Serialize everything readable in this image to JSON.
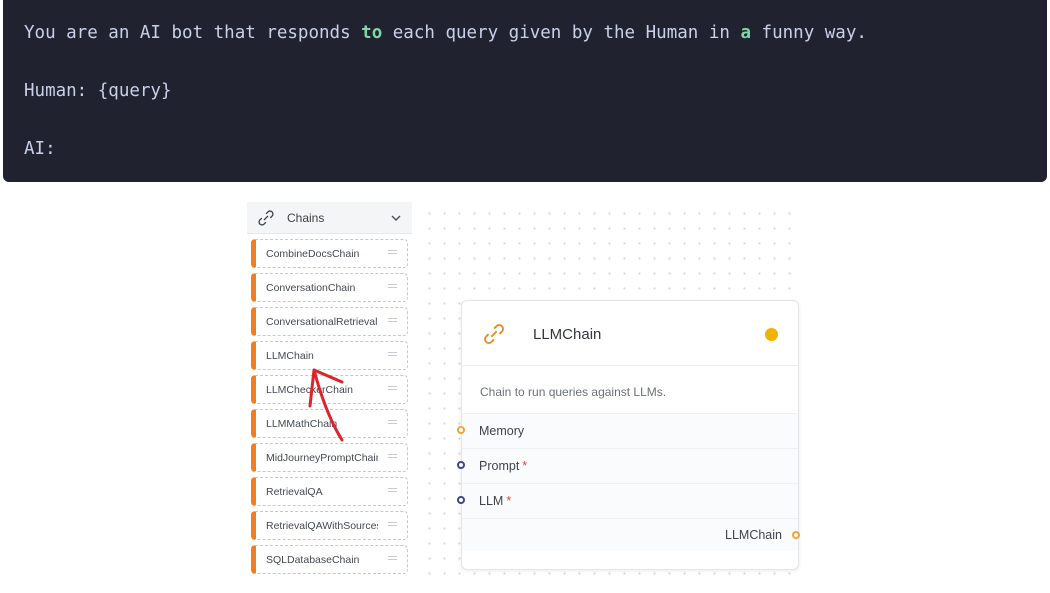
{
  "code": {
    "line1_parts": [
      {
        "text": "You are an AI bot that responds ",
        "kw": false
      },
      {
        "text": "to",
        "kw": true
      },
      {
        "text": " each query given by the Human in ",
        "kw": false
      },
      {
        "text": "a",
        "kw": true
      },
      {
        "text": " funny way.",
        "kw": false
      }
    ],
    "line2": "Human: {query}",
    "line3": "AI:"
  },
  "sidebar": {
    "title": "Chains",
    "header_icon": "link-icon",
    "collapse_icon": "chevron-down-icon",
    "items": [
      {
        "label": "CombineDocsChain"
      },
      {
        "label": "ConversationChain"
      },
      {
        "label": "ConversationalRetrieval..."
      },
      {
        "label": "LLMChain"
      },
      {
        "label": "LLMCheckerChain"
      },
      {
        "label": "LLMMathChain"
      },
      {
        "label": "MidJourneyPromptChain"
      },
      {
        "label": "RetrievalQA"
      },
      {
        "label": "RetrievalQAWithSources..."
      },
      {
        "label": "SQLDatabaseChain"
      }
    ],
    "item_accent_color": "#f37d1f"
  },
  "node": {
    "title": "LLMChain",
    "icon": "link-icon",
    "status_color": "#f2b200",
    "description": "Chain to run queries against LLMs.",
    "inputs": [
      {
        "label": "Memory",
        "required": false,
        "required_mark": ""
      },
      {
        "label": "Prompt",
        "required": true,
        "required_mark": "*"
      },
      {
        "label": "LLM",
        "required": true,
        "required_mark": "*"
      }
    ],
    "output": {
      "label": "LLMChain"
    }
  },
  "annotation": {
    "icon": "red-arrow-icon",
    "color": "#d9262c"
  }
}
